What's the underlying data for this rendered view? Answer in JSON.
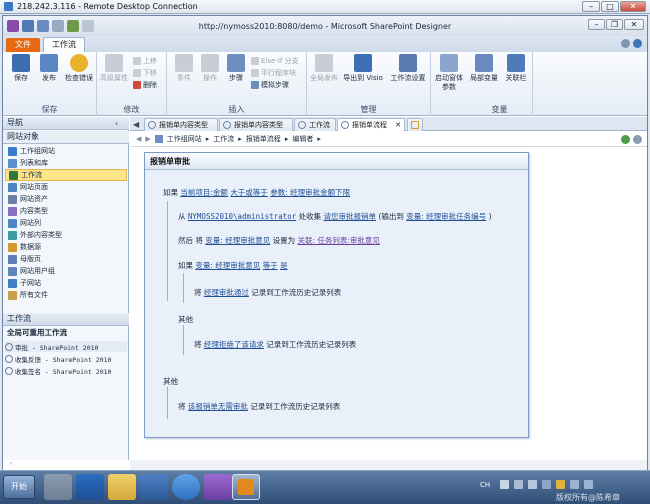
{
  "rdp": {
    "title": "218.242.3.116 - Remote Desktop Connection"
  },
  "app": {
    "title": "http://nymoss2010:8080/demo - Microsoft SharePoint Designer"
  },
  "ribbon_tabs": {
    "file": "文件",
    "workflow": "工作流"
  },
  "ribbon": {
    "groups": {
      "save": "保存",
      "modify": "修改",
      "insert": "插入",
      "manage": "管理",
      "variables": "变量"
    },
    "buttons": {
      "save": "保存",
      "publish": "发布",
      "check": "检查错误",
      "advanced": "高级属性",
      "move_up": "上移",
      "move_down": "下移",
      "delete": "删除",
      "condition": "条件",
      "action": "操作",
      "step": "步骤",
      "else_if": "Else-If 分支",
      "parallel": "平行程序块",
      "impersonate": "模拟步骤",
      "publish_all": "全局发布",
      "export_visio": "导出到 Visio",
      "wf_settings": "工作流设置",
      "start_form": "启动窗体参数",
      "local_vars": "局部变量",
      "assoc_cols": "关联栏"
    }
  },
  "nav": {
    "header": "导航",
    "site_objects_header": "网站对象",
    "site_objects": [
      {
        "label": "工作组网站",
        "color": "#3d7cc9"
      },
      {
        "label": "列表和库",
        "color": "#5a8fd0"
      },
      {
        "label": "工作流",
        "color": "#2f7a3a"
      },
      {
        "label": "网站页面",
        "color": "#4f83bf"
      },
      {
        "label": "网站资产",
        "color": "#6a7fa6"
      },
      {
        "label": "内容类型",
        "color": "#8a6cc0"
      },
      {
        "label": "网站列",
        "color": "#4c86c5"
      },
      {
        "label": "外部内容类型",
        "color": "#3c9aa3"
      },
      {
        "label": "数据源",
        "color": "#d19a2d"
      },
      {
        "label": "母版页",
        "color": "#5b7fb3"
      },
      {
        "label": "网站用户组",
        "color": "#5f86b8"
      },
      {
        "label": "子网站",
        "color": "#3e7fc3"
      },
      {
        "label": "所有文件",
        "color": "#c5a048"
      }
    ],
    "workflows_header": "工作流",
    "workflows_sub": "全局可重用工作流",
    "workflows": [
      "审批 - SharePoint 2010",
      "收集反馈 - SharePoint 2010",
      "收集签名 - SharePoint 2010"
    ]
  },
  "tabs": [
    "报销单内容类型",
    "报销单内容类型",
    "工作流",
    "报销单流程"
  ],
  "breadcrumb": [
    "工作组网站",
    "工作流",
    "报销单流程",
    "编辑者"
  ],
  "workflow": {
    "step_title": "报销单审批",
    "l1": {
      "w1": "如果",
      "f": "当前项目:金额",
      "op": "大于或等于",
      "v": "参数: 经理审批金额下限"
    },
    "l2": {
      "w1": "从",
      "user": "NYMOSS2010\\administrator",
      "w2": "处收集",
      "task": "请您审批报销单",
      "w3": "(输出到",
      "out": "变量: 经理审批任务编号",
      "w4": ")"
    },
    "l3": {
      "w1": "然后 将",
      "var": "变量: 经理审批意见",
      "w2": "设置为",
      "val": "关联: 任务列表:审批意见"
    },
    "l4": {
      "w1": "如果",
      "var": "变量: 经理审批意见",
      "op": "等于",
      "val": "是"
    },
    "l5": {
      "w1": "将",
      "msg": "经理审批通过",
      "w2": "记录到工作流历史记录列表"
    },
    "l6": {
      "w1": "其他"
    },
    "l7": {
      "w1": "将",
      "msg": "经理拒绝了该请求",
      "w2": "记录到工作流历史记录列表"
    },
    "l8": {
      "w1": "其他"
    },
    "l9": {
      "w1": "将",
      "msg": "该报销单无需审批",
      "w2": "记录到工作流历史记录列表"
    }
  },
  "taskbar": {
    "start": "开始",
    "lang": "CH",
    "watermark": "版权所有@陈希章"
  }
}
